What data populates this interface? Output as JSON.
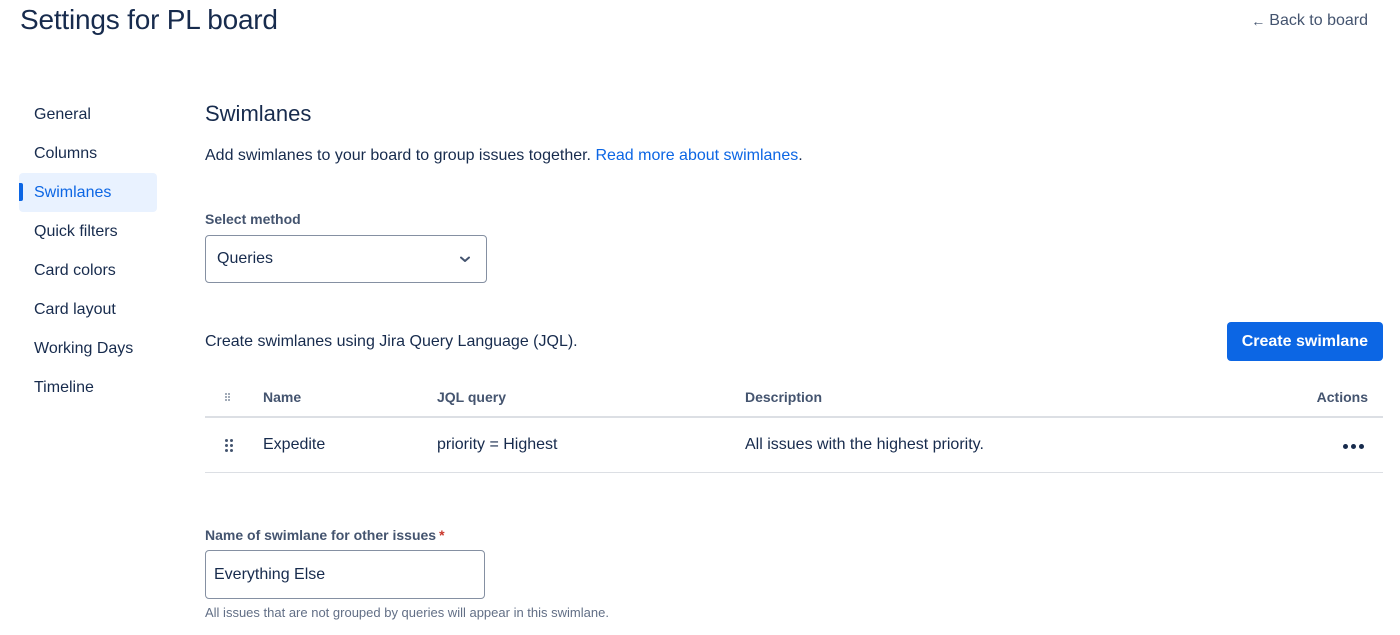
{
  "header": {
    "title": "Settings for PL board",
    "back_arrow": "←",
    "back_label": "Back to board"
  },
  "sidebar": {
    "items": [
      {
        "label": "General",
        "active": false
      },
      {
        "label": "Columns",
        "active": false
      },
      {
        "label": "Swimlanes",
        "active": true
      },
      {
        "label": "Quick filters",
        "active": false
      },
      {
        "label": "Card colors",
        "active": false
      },
      {
        "label": "Card layout",
        "active": false
      },
      {
        "label": "Working Days",
        "active": false
      },
      {
        "label": "Timeline",
        "active": false
      }
    ]
  },
  "main": {
    "title": "Swimlanes",
    "intro_text": "Add swimlanes to your board to group issues together. ",
    "intro_link": "Read more about swimlanes",
    "intro_end": ".",
    "select_method": {
      "label": "Select method",
      "value": "Queries"
    },
    "jql_text": "Create swimlanes using Jira Query Language (JQL).",
    "create_button": "Create swimlane",
    "table": {
      "headers": {
        "name": "Name",
        "jql": "JQL query",
        "description": "Description",
        "actions": "Actions"
      },
      "rows": [
        {
          "name": "Expedite",
          "jql": "priority = Highest",
          "description": "All issues with the highest priority."
        }
      ]
    },
    "other_issues": {
      "label": "Name of swimlane for other issues",
      "required_marker": "*",
      "value": "Everything Else",
      "helper": "All issues that are not grouped by queries will appear in this swimlane."
    }
  },
  "colors": {
    "accent": "#0c66e4",
    "text": "#172b4d",
    "subtle": "#44546f",
    "active_bg": "#e9f2ff",
    "required": "#c9372c"
  }
}
